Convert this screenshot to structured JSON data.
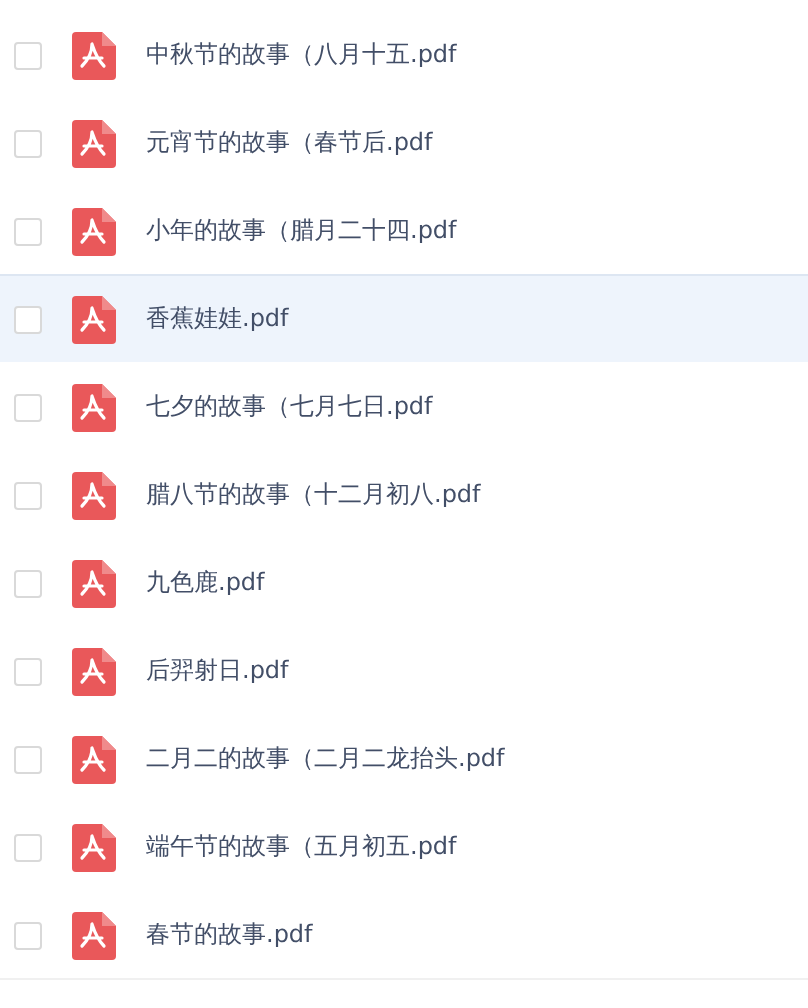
{
  "files": [
    {
      "name": "中秋节的故事（八月十五.pdf",
      "checked": false,
      "hovered": false
    },
    {
      "name": "元宵节的故事（春节后.pdf",
      "checked": false,
      "hovered": false
    },
    {
      "name": "小年的故事（腊月二十四.pdf",
      "checked": false,
      "hovered": false
    },
    {
      "name": "香蕉娃娃.pdf",
      "checked": false,
      "hovered": true
    },
    {
      "name": "七夕的故事（七月七日.pdf",
      "checked": false,
      "hovered": false
    },
    {
      "name": "腊八节的故事（十二月初八.pdf",
      "checked": false,
      "hovered": false
    },
    {
      "name": "九色鹿.pdf",
      "checked": false,
      "hovered": false
    },
    {
      "name": "后羿射日.pdf",
      "checked": false,
      "hovered": false
    },
    {
      "name": "二月二的故事（二月二龙抬头.pdf",
      "checked": false,
      "hovered": false
    },
    {
      "name": "端午节的故事（五月初五.pdf",
      "checked": false,
      "hovered": false
    },
    {
      "name": "春节的故事.pdf",
      "checked": false,
      "hovered": false
    }
  ]
}
